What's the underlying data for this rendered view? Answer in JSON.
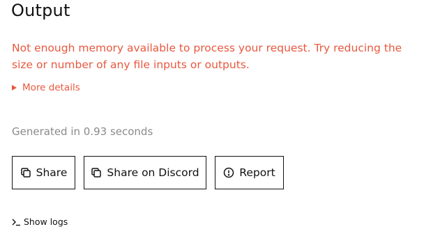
{
  "output": {
    "title": "Output",
    "error_message": "Not enough memory available to process your request. Try reducing the size or number of any file inputs or outputs.",
    "more_details_label": "More details",
    "generated_text": "Generated in 0.93 seconds"
  },
  "actions": {
    "share_label": "Share",
    "share_discord_label": "Share on Discord",
    "report_label": "Report"
  },
  "logs": {
    "show_logs_label": "Show logs"
  },
  "icons": {
    "share": "copy-icon",
    "discord": "copy-icon",
    "report": "alert-circle-icon",
    "more_details": "triangle-right-icon",
    "logs": "terminal-prompt-icon"
  },
  "colors": {
    "error": "#e8583f",
    "muted": "#8a8a8a",
    "text": "#111111"
  }
}
